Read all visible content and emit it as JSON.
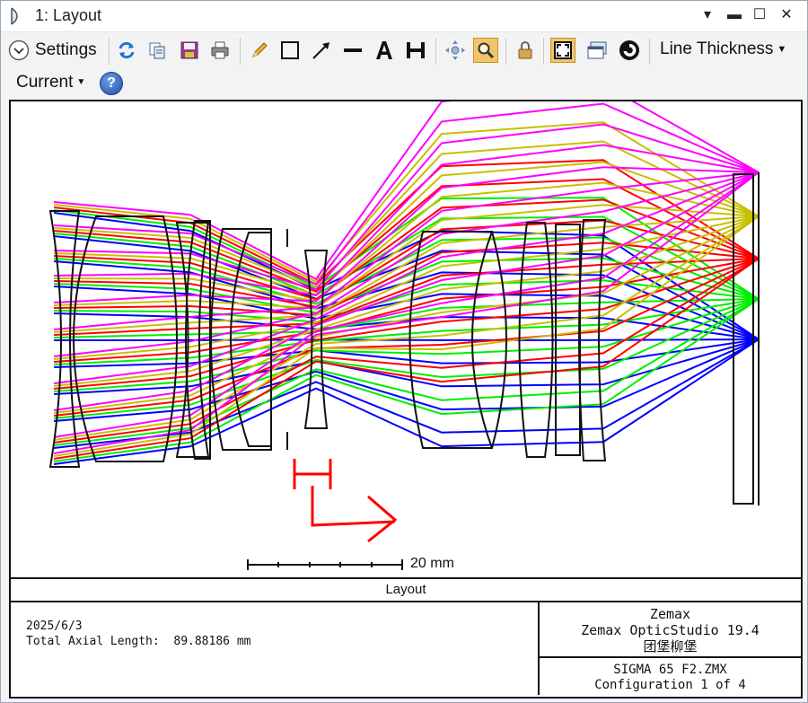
{
  "window": {
    "title": "1: Layout"
  },
  "toolbar": {
    "settings_label": "Settings",
    "line_thickness_label": "Line Thickness",
    "current_label": "Current"
  },
  "plot": {
    "caption": "Layout",
    "scale_bar_label": "20 mm",
    "info_date": "2025/6/3",
    "info_length_label": "Total Axial Length:",
    "info_length_value": "89.88186 mm",
    "brand": "Zemax",
    "product": "Zemax OpticStudio 19.4",
    "owner": "团堡柳堡",
    "file_name": "SIGMA 65 F2.ZMX",
    "configuration": "Configuration 1 of 4"
  },
  "ray_colors": {
    "field1": "#0000ff",
    "field2": "#00ee00",
    "field3": "#ff0000",
    "field4": "#c8c000",
    "field5": "#ff00ff",
    "annotation": "#ff0000"
  }
}
